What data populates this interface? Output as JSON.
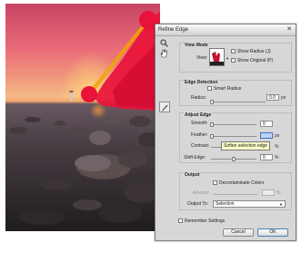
{
  "dialog": {
    "title": "Refine Edge",
    "close_glyph": "✕",
    "view_mode": {
      "heading": "View Mode",
      "view_label": "View:",
      "show_radius_label": "Show Radius (J)",
      "show_original_label": "Show Original (P)"
    },
    "edge_detection": {
      "heading": "Edge Detection",
      "smart_radius_label": "Smart Radius",
      "radius_label": "Radius:",
      "radius_value": "0.0",
      "radius_unit": "px"
    },
    "adjust_edge": {
      "heading": "Adjust Edge",
      "smooth_label": "Smooth:",
      "smooth_value": "0",
      "feather_label": "Feather:",
      "feather_unit": "px",
      "contrast_label": "Contrast:",
      "contrast_unit": "%",
      "shift_edge_label": "Shift Edge:",
      "shift_edge_value": "0",
      "shift_edge_unit": "%"
    },
    "output": {
      "heading": "Output",
      "decontaminate_label": "Decontaminate Colors",
      "amount_label": "Amount:",
      "output_to_label": "Output To:",
      "output_to_value": "Selection"
    },
    "remember_label": "Remember Settings",
    "cancel_label": "Cancel",
    "ok_label": "OK",
    "tooltip": "Soften selection edge"
  },
  "colors": {
    "dialog_bg": "#d7d7d7",
    "ok_border": "#4a7fc1",
    "overlay_red": "#e8123a",
    "brush_stroke": "#f2a400",
    "tooltip_bg": "#fdfdc8"
  },
  "icons": [
    "zoom-icon",
    "hand-icon",
    "refine-radius-brush-icon",
    "view-thumbnail-icon",
    "dropdown-arrow-icon",
    "close-icon"
  ]
}
